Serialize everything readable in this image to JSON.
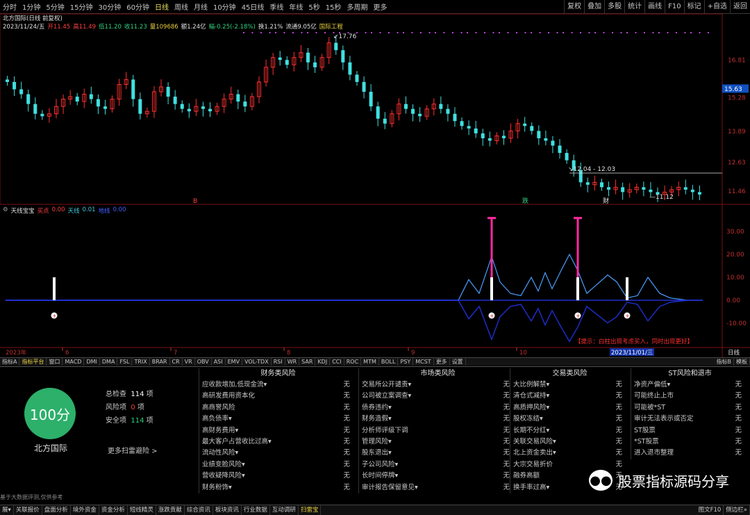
{
  "toolbar": {
    "periods": [
      "分时",
      "1分钟",
      "5分钟",
      "15分钟",
      "30分钟",
      "60分钟",
      "日线",
      "周线",
      "月线",
      "10分钟",
      "45日线",
      "季线",
      "年线",
      "5秒",
      "15秒",
      "多周期",
      "更多"
    ],
    "active_period": "日线",
    "tools": [
      "复权",
      "叠加",
      "多股",
      "统计",
      "画线",
      "F10",
      "标记",
      "+自选",
      "返回"
    ]
  },
  "stock": {
    "title": "北方国际(日线 前复权)",
    "date": "2023/11/24/五",
    "open": "开11.45",
    "high": "高11.49",
    "low": "低11.20",
    "close": "收11.23",
    "volume": "量109686",
    "amount": "额1.24亿",
    "change": "幅-0.25(-2.18%)",
    "turnover": "换1.21%",
    "float": "流通9.05亿",
    "concept": "国际工程"
  },
  "price_axis": {
    "labels": [
      "16.81",
      "15.63",
      "15.28",
      "13.89",
      "12.63",
      "11.46"
    ],
    "current": "15.63"
  },
  "annotations": {
    "high_label": "17.76",
    "range_label": "12.04 - 12.03",
    "low_label": "11.12",
    "event_marks": [
      "B",
      "跌",
      "财"
    ]
  },
  "indicator": {
    "name": "天线宝宝",
    "buy_label": "买点",
    "buy_value": "0.00",
    "line_label": "天线",
    "line_value": "0.01",
    "other_label": "地线",
    "other_value": "0.00",
    "axis_labels": [
      "30.00",
      "20.00",
      "10.00",
      "0.00",
      "-10.00"
    ],
    "note": "【提示：白柱出现考虑买入，同时出现更好】"
  },
  "time_axis": {
    "labels": [
      "2023年",
      "6",
      "7",
      "8",
      "9",
      "10"
    ],
    "cursor_date": "2023/11/01/三",
    "period": "日线"
  },
  "indicator_tabs": [
    "指标A",
    "指标平台",
    "窗口",
    "MACD",
    "DMI",
    "DMA",
    "FSL",
    "TRIX",
    "BRAR",
    "CR",
    "VR",
    "OBV",
    "ASI",
    "EMV",
    "VOL-TDX",
    "RSI",
    "WR",
    "SAR",
    "KDJ",
    "CCI",
    "ROC",
    "MTM",
    "BOLL",
    "PSY",
    "MCST",
    "更多",
    "设置"
  ],
  "active_indicator_tab": "指标平台",
  "indicator_tabs_right": [
    "指标B",
    "模板"
  ],
  "scan": {
    "score": "100分",
    "company": "北方国际",
    "total_label": "总检查",
    "total_value": "114",
    "risk_label": "风险项",
    "risk_value": "0",
    "safe_label": "安全项",
    "safe_value": "114",
    "unit": "项",
    "more": "更多扫雷避险 >",
    "disclaimer": "基于大数据评测,仅供参考"
  },
  "risk_columns": [
    {
      "header": "财务类风险",
      "rows": [
        {
          "name": "应收款增加,低现金流▾",
          "status": "无"
        },
        {
          "name": "高研发费用资本化",
          "status": "无"
        },
        {
          "name": "高商誉风险",
          "status": "无"
        },
        {
          "name": "高负债率▾",
          "status": "无"
        },
        {
          "name": "高财务费用▾",
          "status": "无"
        },
        {
          "name": "最大客户占营收比过高▾",
          "status": "无"
        },
        {
          "name": "流动性风险▾",
          "status": "无"
        },
        {
          "name": "业绩变脸风险▾",
          "status": "无"
        },
        {
          "name": "营收疑降风险▾",
          "status": "无"
        },
        {
          "name": "财务粉饰▾",
          "status": "无"
        }
      ]
    },
    {
      "header": "市场类风险",
      "rows": [
        {
          "name": "交易所公开谴责▾",
          "status": "无"
        },
        {
          "name": "公司被立案调查▾",
          "status": "无"
        },
        {
          "name": "债券违约▾",
          "status": "无"
        },
        {
          "name": "财务造假▾",
          "status": "无"
        },
        {
          "name": "分析师评级下调",
          "status": "无"
        },
        {
          "name": "管理风险▾",
          "status": "无"
        },
        {
          "name": "股东退出▾",
          "status": "无"
        },
        {
          "name": "子公司风险▾",
          "status": "无"
        },
        {
          "name": "长时间停牌▾",
          "status": "无"
        },
        {
          "name": "审计报告保留意见▾",
          "status": "无"
        }
      ]
    },
    {
      "header": "交易类风险",
      "rows": [
        {
          "name": "大比例解禁▾",
          "status": "无"
        },
        {
          "name": "清仓式减持▾",
          "status": "无"
        },
        {
          "name": "高质押风险▾",
          "status": "无"
        },
        {
          "name": "股权冻结▾",
          "status": "无"
        },
        {
          "name": "长期不分红▾",
          "status": "无"
        },
        {
          "name": "关联交易风险▾",
          "status": "无"
        },
        {
          "name": "北上资金卖出▾",
          "status": "无"
        },
        {
          "name": "大宗交易折价",
          "status": "无"
        },
        {
          "name": "融券高额",
          "status": "无"
        },
        {
          "name": "换手率过高▾",
          "status": "无"
        }
      ]
    },
    {
      "header": "ST风险和退市",
      "rows": [
        {
          "name": "净资产偏低▾",
          "status": "无"
        },
        {
          "name": "可能终止上市",
          "status": "无"
        },
        {
          "name": "可能被*ST",
          "status": "无"
        },
        {
          "name": "审计无法表示或否定",
          "status": "无"
        },
        {
          "name": "ST股票",
          "status": "无"
        },
        {
          "name": "*ST股票",
          "status": "无"
        },
        {
          "name": "进入退市整理",
          "status": "无"
        }
      ]
    }
  ],
  "watermark": "股票指标源码分享",
  "statusbar": {
    "items": [
      "展▾",
      "关联报价",
      "盘面分析",
      "境外资金",
      "资金分析",
      "短线精灵",
      "涨跌贡献",
      "综合资讯",
      "板块资讯",
      "行业数据",
      "互动调研",
      "扫雷宝"
    ],
    "active": "扫雷宝",
    "right": [
      "图文F10",
      "侧边栏»"
    ]
  },
  "colors": {
    "up": "#ff3030",
    "down": "#40e0e0",
    "sky_line": "#4a9fff",
    "ground_line": "#1e2fd0",
    "white_bar": "#ffffff",
    "magenta_bar": "#ff2aa0",
    "score_bg": "#2cb06a"
  }
}
